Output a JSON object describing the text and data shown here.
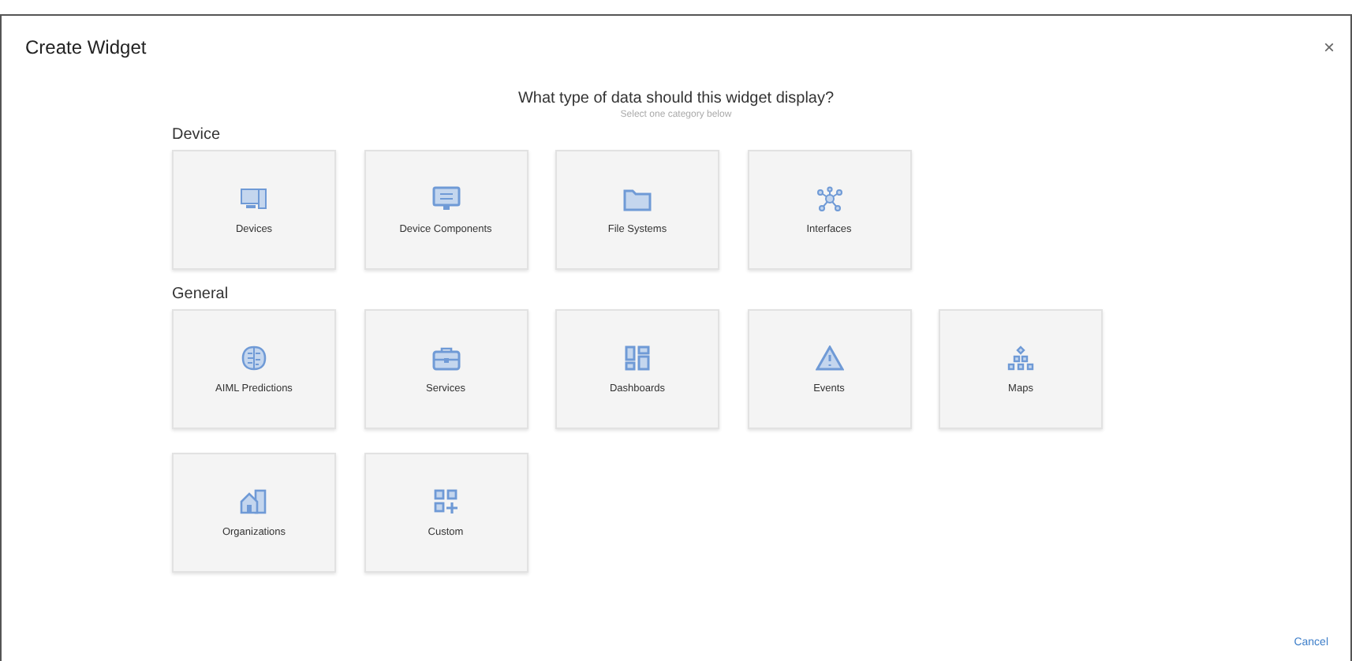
{
  "dialog": {
    "title": "Create Widget",
    "close": "×"
  },
  "prompt": {
    "heading": "What type of data should this widget display?",
    "hint": "Select one category below"
  },
  "sections": [
    {
      "title": "Device",
      "cards": [
        {
          "label": "Devices",
          "kind": "devices"
        },
        {
          "label": "Device Components",
          "kind": "components"
        },
        {
          "label": "File Systems",
          "kind": "folder"
        },
        {
          "label": "Interfaces",
          "kind": "network"
        }
      ]
    },
    {
      "title": "General",
      "cards": [
        {
          "label": "AIML Predictions",
          "kind": "brain"
        },
        {
          "label": "Services",
          "kind": "briefcase"
        },
        {
          "label": "Dashboards",
          "kind": "dashboard"
        },
        {
          "label": "Events",
          "kind": "warning"
        },
        {
          "label": "Maps",
          "kind": "hierarchy"
        },
        {
          "label": "Organizations",
          "kind": "building"
        },
        {
          "label": "Custom",
          "kind": "custom"
        }
      ]
    }
  ],
  "footer": {
    "cancel": "Cancel"
  }
}
